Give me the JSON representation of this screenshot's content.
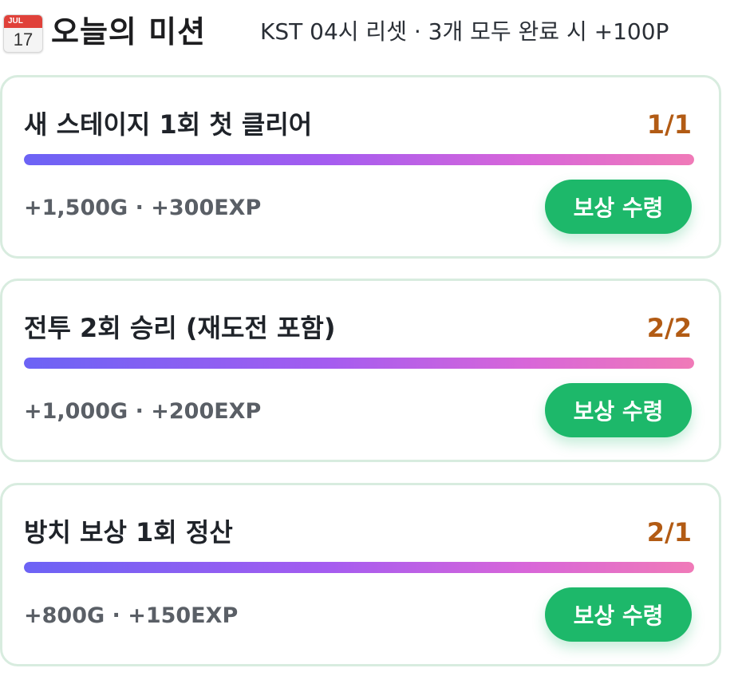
{
  "header": {
    "icon": "calendar-icon",
    "calendar_month": "JUL",
    "calendar_day": "17",
    "title": "오늘의 미션",
    "subtitle": "KST 04시 리셋 · 3개 모두 완료 시 +100P"
  },
  "colors": {
    "claim_button": "#1db86a",
    "progress_text": "#b25b14",
    "card_border": "#d8ecdf",
    "bar_gradient_start": "#6c63f5",
    "bar_gradient_end": "#f07ab8"
  },
  "missions": [
    {
      "name": "새 스테이지 1회 첫 클리어",
      "progress": "1/1",
      "progress_fraction": 1.0,
      "reward": "+1,500G · +300EXP",
      "button_label": "보상 수령"
    },
    {
      "name": "전투 2회 승리 (재도전 포함)",
      "progress": "2/2",
      "progress_fraction": 1.0,
      "reward": "+1,000G · +200EXP",
      "button_label": "보상 수령"
    },
    {
      "name": "방치 보상 1회 정산",
      "progress": "2/1",
      "progress_fraction": 1.0,
      "reward": "+800G · +150EXP",
      "button_label": "보상 수령"
    }
  ]
}
